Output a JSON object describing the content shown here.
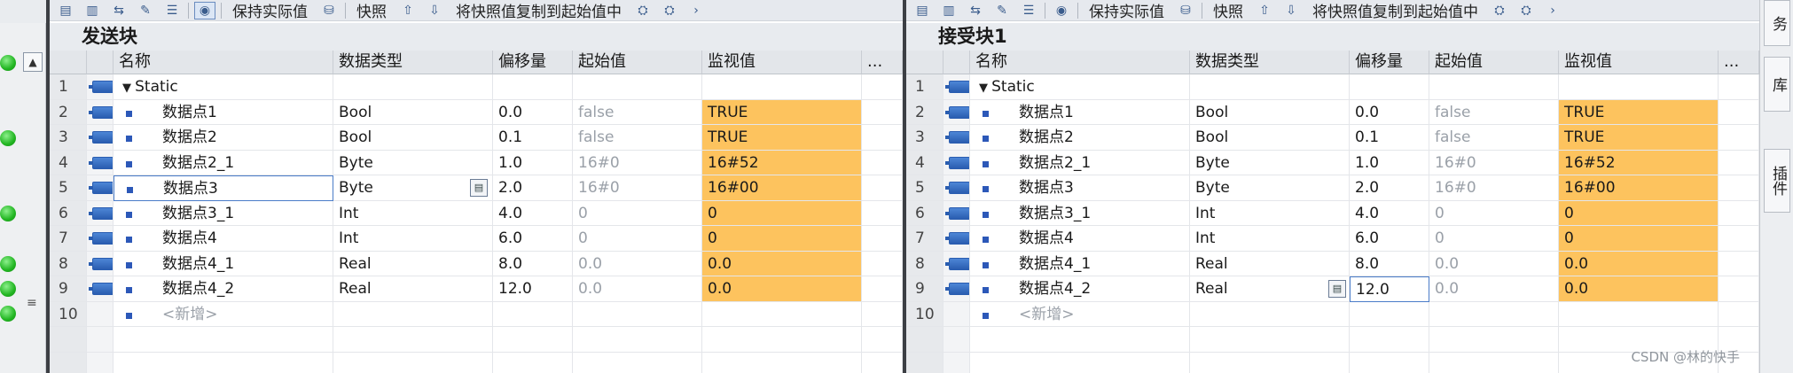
{
  "toolbar": {
    "keep_actual": "保持实际值",
    "snapshot": "快照",
    "copy_snapshot": "将快照值复制到起始值中"
  },
  "blocks": [
    {
      "title": "发送块",
      "headers": [
        "名称",
        "数据类型",
        "偏移量",
        "起始值",
        "监视值",
        "..."
      ],
      "rows": [
        {
          "num": "1",
          "name": "Static",
          "type": "",
          "offset": "",
          "start": "",
          "watch": ""
        },
        {
          "num": "2",
          "name": "数据点1",
          "type": "Bool",
          "offset": "0.0",
          "start": "false",
          "watch": "TRUE"
        },
        {
          "num": "3",
          "name": "数据点2",
          "type": "Bool",
          "offset": "0.1",
          "start": "false",
          "watch": "TRUE"
        },
        {
          "num": "4",
          "name": "数据点2_1",
          "type": "Byte",
          "offset": "1.0",
          "start": "16#0",
          "watch": "16#52"
        },
        {
          "num": "5",
          "name": "数据点3",
          "type": "Byte",
          "offset": "2.0",
          "start": "16#0",
          "watch": "16#00"
        },
        {
          "num": "6",
          "name": "数据点3_1",
          "type": "Int",
          "offset": "4.0",
          "start": "0",
          "watch": "0"
        },
        {
          "num": "7",
          "name": "数据点4",
          "type": "Int",
          "offset": "6.0",
          "start": "0",
          "watch": "0"
        },
        {
          "num": "8",
          "name": "数据点4_1",
          "type": "Real",
          "offset": "8.0",
          "start": "0.0",
          "watch": "0.0"
        },
        {
          "num": "9",
          "name": "数据点4_2",
          "type": "Real",
          "offset": "12.0",
          "start": "0.0",
          "watch": "0.0"
        },
        {
          "num": "10",
          "name": "<新增>",
          "type": "",
          "offset": "",
          "start": "",
          "watch": ""
        }
      ]
    },
    {
      "title": "接受块1",
      "headers": [
        "名称",
        "数据类型",
        "偏移量",
        "起始值",
        "监视值",
        "..."
      ],
      "rows": [
        {
          "num": "1",
          "name": "Static",
          "type": "",
          "offset": "",
          "start": "",
          "watch": ""
        },
        {
          "num": "2",
          "name": "数据点1",
          "type": "Bool",
          "offset": "0.0",
          "start": "false",
          "watch": "TRUE"
        },
        {
          "num": "3",
          "name": "数据点2",
          "type": "Bool",
          "offset": "0.1",
          "start": "false",
          "watch": "TRUE"
        },
        {
          "num": "4",
          "name": "数据点2_1",
          "type": "Byte",
          "offset": "1.0",
          "start": "16#0",
          "watch": "16#52"
        },
        {
          "num": "5",
          "name": "数据点3",
          "type": "Byte",
          "offset": "2.0",
          "start": "16#0",
          "watch": "16#00"
        },
        {
          "num": "6",
          "name": "数据点3_1",
          "type": "Int",
          "offset": "4.0",
          "start": "0",
          "watch": "0"
        },
        {
          "num": "7",
          "name": "数据点4",
          "type": "Int",
          "offset": "6.0",
          "start": "0",
          "watch": "0"
        },
        {
          "num": "8",
          "name": "数据点4_1",
          "type": "Real",
          "offset": "8.0",
          "start": "0.0",
          "watch": "0.0"
        },
        {
          "num": "9",
          "name": "数据点4_2",
          "type": "Real",
          "offset": "12.0",
          "start": "0.0",
          "watch": "0.0"
        },
        {
          "num": "10",
          "name": "<新增>",
          "type": "",
          "offset": "",
          "start": "",
          "watch": ""
        }
      ]
    }
  ],
  "sidebar_tabs": [
    "务",
    "库",
    "插件"
  ],
  "watermark": "CSDN @林的快手",
  "colors": {
    "watch_bg": "#fdc35e",
    "status_ok": "#21b521",
    "icon_blue": "#2a5db0"
  }
}
